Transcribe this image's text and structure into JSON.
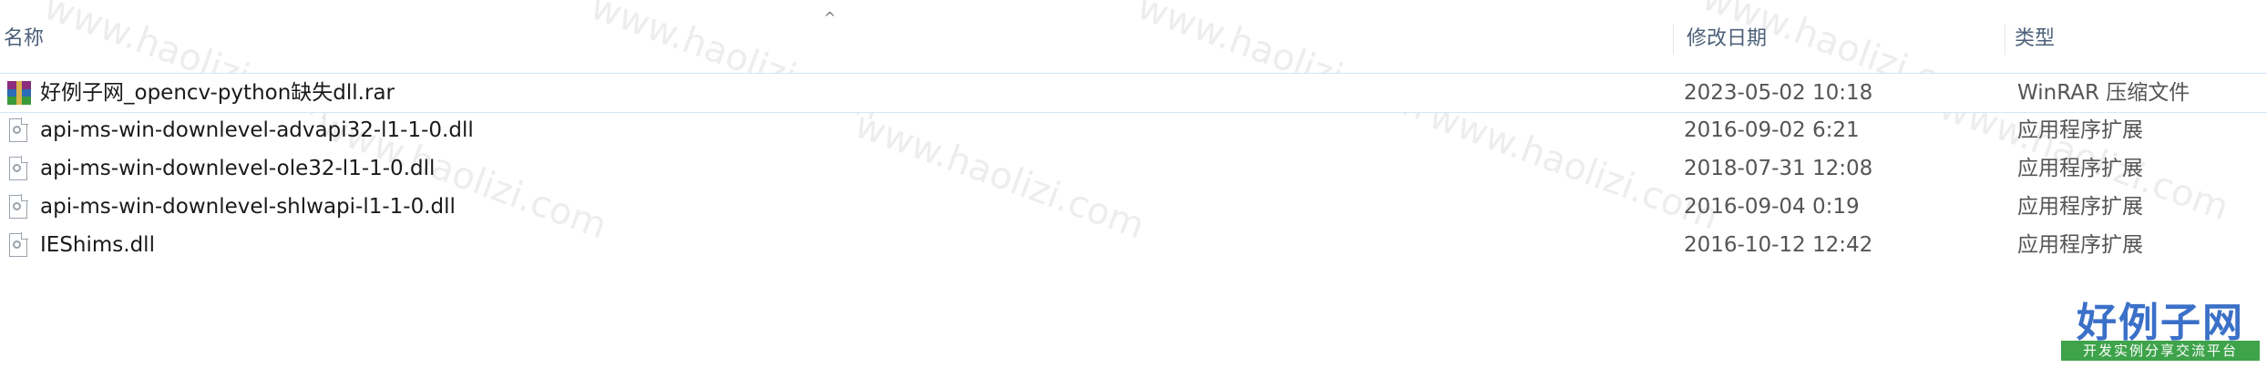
{
  "header": {
    "name_label": "名称",
    "date_label": "修改日期",
    "type_label": "类型",
    "sort_indicator": "^"
  },
  "files": [
    {
      "name": "好例子网_opencv-python缺失dll.rar",
      "date": "2023-05-02 10:18",
      "type": "WinRAR 压缩文件",
      "icon": "rar-archive-icon"
    },
    {
      "name": "api-ms-win-downlevel-advapi32-l1-1-0.dll",
      "date": "2016-09-02 6:21",
      "type": "应用程序扩展",
      "icon": "dll-file-icon"
    },
    {
      "name": "api-ms-win-downlevel-ole32-l1-1-0.dll",
      "date": "2018-07-31 12:08",
      "type": "应用程序扩展",
      "icon": "dll-file-icon"
    },
    {
      "name": "api-ms-win-downlevel-shlwapi-l1-1-0.dll",
      "date": "2016-09-04 0:19",
      "type": "应用程序扩展",
      "icon": "dll-file-icon"
    },
    {
      "name": "IEShims.dll",
      "date": "2016-10-12 12:42",
      "type": "应用程序扩展",
      "icon": "dll-file-icon"
    }
  ],
  "watermark": {
    "text": "www.haolizi.com"
  },
  "logo": {
    "title": "好例子网",
    "subtitle": "开发实例分享交流平台"
  }
}
